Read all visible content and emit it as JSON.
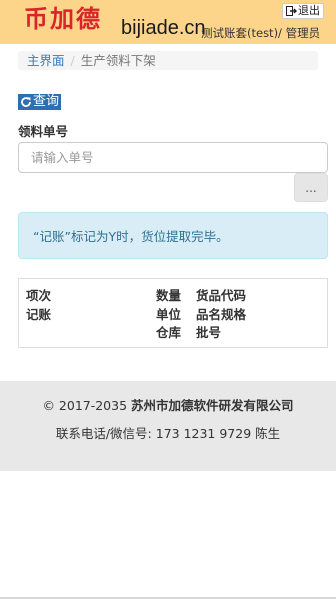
{
  "header": {
    "logo_text": "币加德",
    "site_domain": "bijiade.cn",
    "user_info": "测试账套(test)/ 管理员",
    "logout_label": "退出",
    "background_color": "#fdd58a",
    "logo_color": "#d9252a"
  },
  "breadcrumb": {
    "home": "主界面",
    "separator": "/",
    "current": "生产领料下架"
  },
  "toolbar": {
    "query_label": "查询",
    "query_icon": "refresh-icon"
  },
  "form": {
    "order_label": "领料单号",
    "order_value": "",
    "order_placeholder": "请输入单号",
    "more_label": "..."
  },
  "alert": {
    "text": "“记账”标记为Y时，货位提取完毕。",
    "background_color": "#d9edf7"
  },
  "list_header": {
    "col1": [
      "项次",
      "记账"
    ],
    "col2": [
      "数量",
      "单位",
      "仓库"
    ],
    "col3": [
      "货品代码",
      "品名规格",
      "批号"
    ]
  },
  "footer": {
    "copyright_prefix": "© 2017-2035 ",
    "company": "苏州市加德软件研发有限公司",
    "contact": "联系电话/微信号: 173 1231 9729 陈生"
  }
}
